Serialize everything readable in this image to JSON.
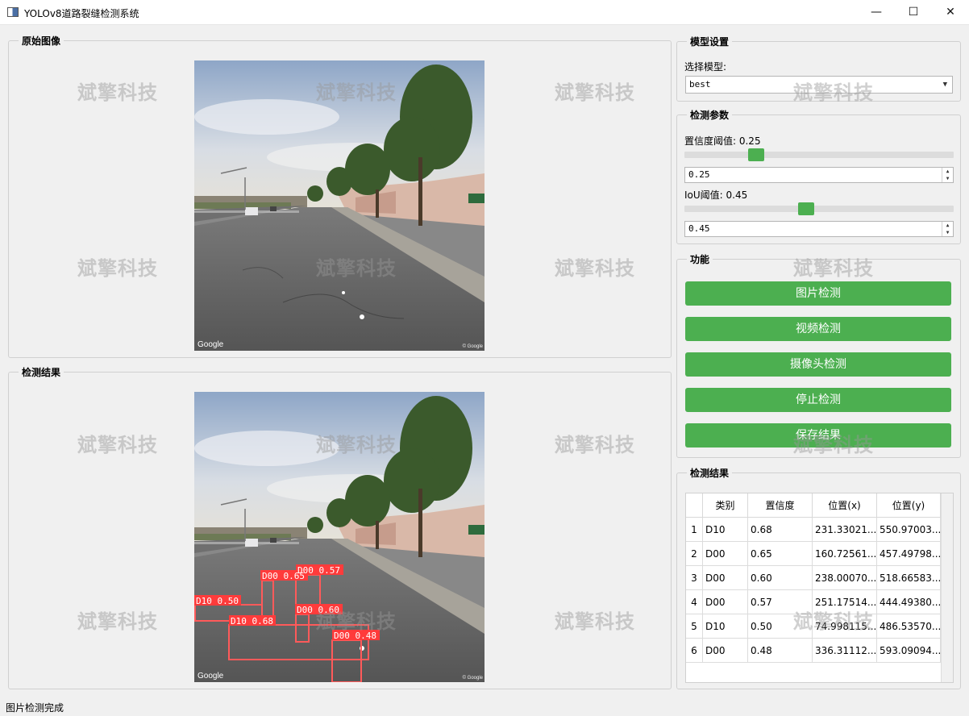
{
  "window": {
    "title": "YOLOv8道路裂缝检测系统",
    "minimize": "—",
    "maximize": "☐",
    "close": "✕"
  },
  "panels": {
    "original_title": "原始图像",
    "result_title": "检测结果"
  },
  "image": {
    "google_mark": "Google",
    "copyright_mark": "© Google"
  },
  "watermark": "斌擎科技",
  "model_settings": {
    "title": "模型设置",
    "select_label": "选择模型:",
    "selected_model": "best"
  },
  "detect_params": {
    "title": "检测参数",
    "conf_label": "置信度阈值: 0.25",
    "conf_value": "0.25",
    "conf_level": 0.25,
    "iou_label": "IoU阈值: 0.45",
    "iou_value": "0.45",
    "iou_level": 0.45
  },
  "functions": {
    "title": "功能",
    "image_detect": "图片检测",
    "video_detect": "视频检测",
    "camera_detect": "摄像头检测",
    "stop_detect": "停止检测",
    "save_results": "保存结果"
  },
  "results_table": {
    "title": "检测结果",
    "headers": [
      "类别",
      "置信度",
      "位置(x)",
      "位置(y)"
    ],
    "rows": [
      {
        "num": "1",
        "cls": "D10",
        "conf": "0.68",
        "x": "231.33021...",
        "y": "550.97003..."
      },
      {
        "num": "2",
        "cls": "D00",
        "conf": "0.65",
        "x": "160.72561...",
        "y": "457.49798..."
      },
      {
        "num": "3",
        "cls": "D00",
        "conf": "0.60",
        "x": "238.00070...",
        "y": "518.66583..."
      },
      {
        "num": "4",
        "cls": "D00",
        "conf": "0.57",
        "x": "251.17514...",
        "y": "444.49380..."
      },
      {
        "num": "5",
        "cls": "D10",
        "conf": "0.50",
        "x": "74.998115...",
        "y": "486.53570..."
      },
      {
        "num": "6",
        "cls": "D00",
        "conf": "0.48",
        "x": "336.31112...",
        "y": "593.09094..."
      }
    ]
  },
  "detection_labels": [
    "D00 0.57",
    "D00 0.65",
    "D10 0.50",
    "D10 0.68",
    "D00 0.60",
    "D00 0.48"
  ],
  "colors": {
    "accent_green": "#4caf50",
    "box_red": "#ff3b3b"
  },
  "status_text": "图片检测完成"
}
